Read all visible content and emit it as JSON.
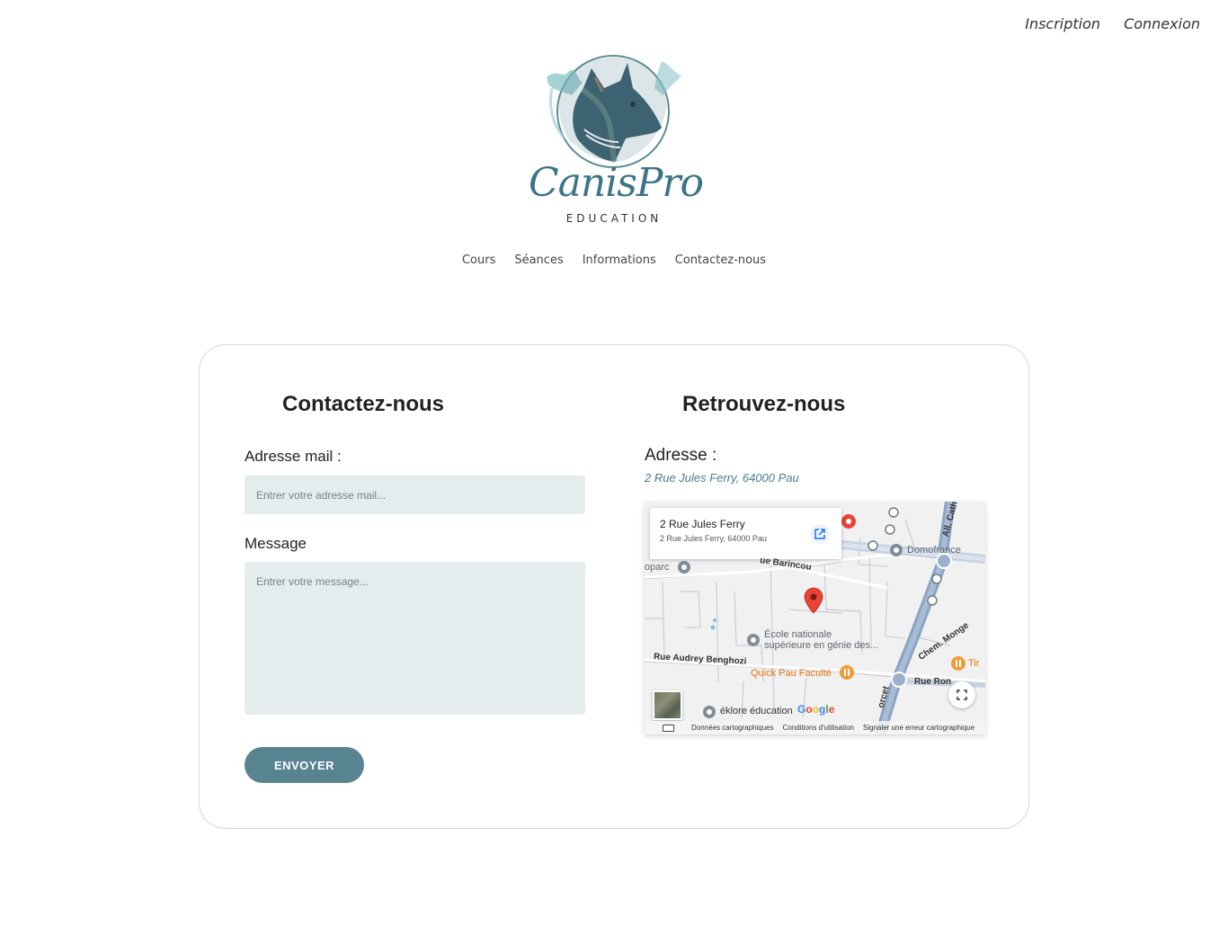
{
  "auth": {
    "signup": "Inscription",
    "login": "Connexion"
  },
  "logo": {
    "name": "CanisPro",
    "subtitle": "EDUCATION"
  },
  "nav": {
    "items": [
      "Cours",
      "Séances",
      "Informations",
      "Contactez-nous"
    ]
  },
  "contact": {
    "title": "Contactez-nous",
    "email_label": "Adresse mail :",
    "email_placeholder": "Entrer votre adresse mail...",
    "message_label": "Message",
    "message_placeholder": "Entrer votre message...",
    "submit": "ENVOYER"
  },
  "location": {
    "title": "Retrouvez-nous",
    "address_label": "Adresse :",
    "address": "2 Rue Jules Ferry, 64000 Pau"
  },
  "map": {
    "info_title": "2 Rue Jules Ferry",
    "info_sub": "2 Rue Jules Ferry, 64000 Pau",
    "labels": {
      "domofrance": "Domofrance",
      "oparc": "oparc",
      "barincou": "ue Barincou",
      "ecole1": "École nationale",
      "ecole2": "supérieure en génie des...",
      "benghozi": "Rue Audrey Benghozi",
      "quick": "Quick Pau Faculté",
      "monge": "Chem. Monge",
      "tir": "Tir",
      "rueron": "Rue Ron",
      "eklore": "éklore éducation",
      "allcath": "All. Cath",
      "dorcet": "orcet"
    },
    "google": [
      "G",
      "o",
      "o",
      "g",
      "l",
      "e"
    ],
    "footer": [
      "Données cartographiques",
      "Conditions d'utilisation",
      "Signaler une erreur cartographique"
    ]
  },
  "colors": {
    "accent": "#588492",
    "field_bg": "#e5eced",
    "link": "#4a7c90",
    "pin": "#ea4335"
  }
}
